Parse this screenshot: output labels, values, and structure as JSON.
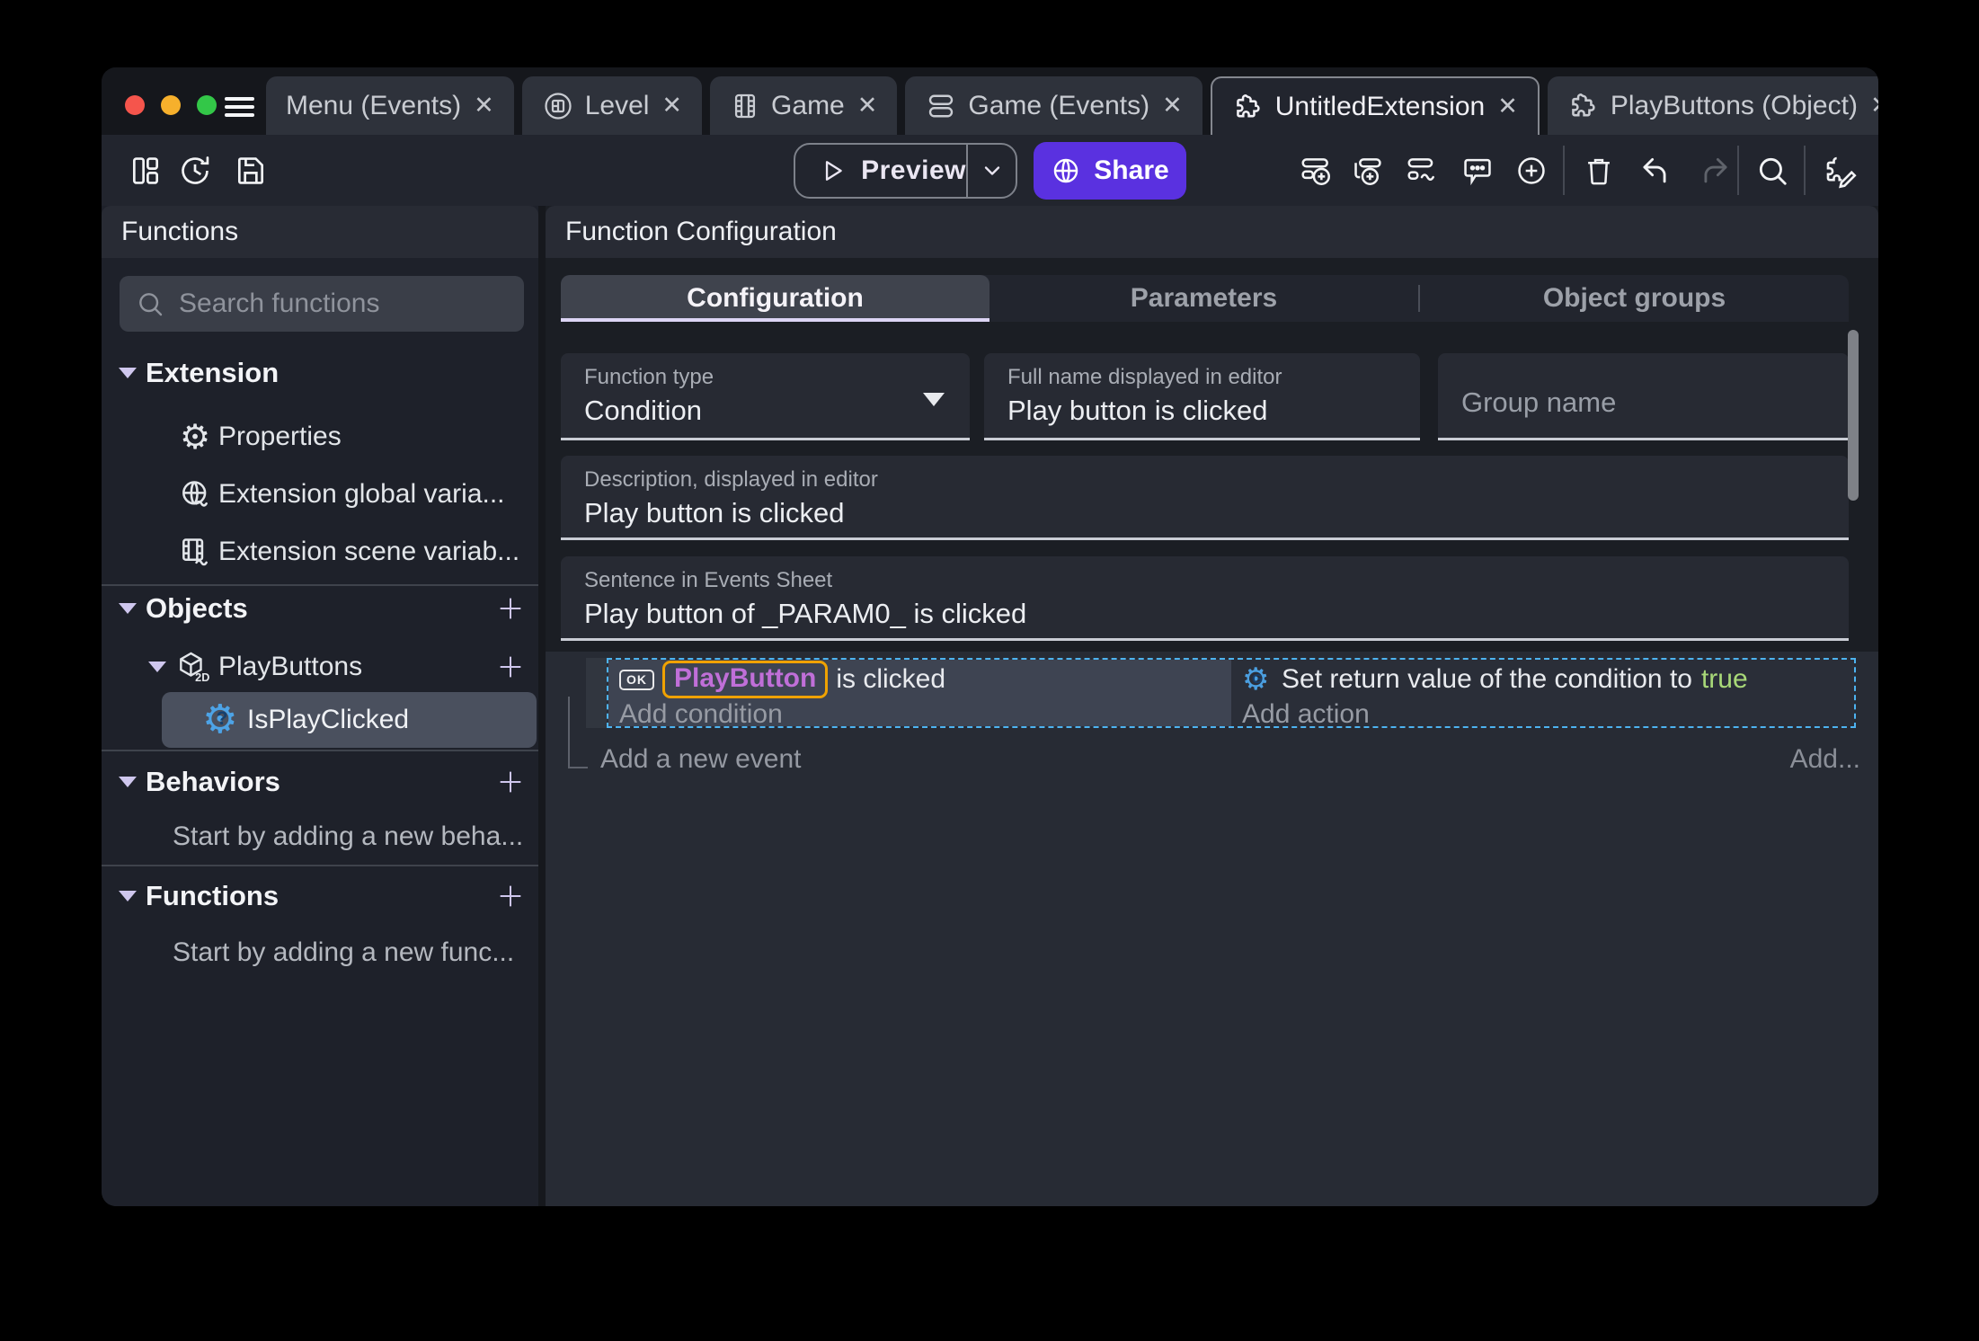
{
  "window": {
    "tabs": [
      {
        "label": "Menu (Events)",
        "icon": "none"
      },
      {
        "label": "Level",
        "icon": "scene-icon"
      },
      {
        "label": "Game",
        "icon": "film-icon"
      },
      {
        "label": "Game (Events)",
        "icon": "events-list-icon"
      },
      {
        "label": "UntitledExtension",
        "icon": "puzzle-icon",
        "active": true
      },
      {
        "label": "PlayButtons (Object)",
        "icon": "puzzle-icon"
      }
    ],
    "close_glyph": "✕"
  },
  "toolbar": {
    "preview_label": "Preview",
    "share_label": "Share"
  },
  "sidebar": {
    "title": "Functions",
    "search_placeholder": "Search functions",
    "sections": {
      "extension": {
        "label": "Extension",
        "items": [
          {
            "label": "Properties"
          },
          {
            "label": "Extension global varia..."
          },
          {
            "label": "Extension scene variab..."
          }
        ]
      },
      "objects": {
        "label": "Objects",
        "object_label": "PlayButtons",
        "object_type": "2D",
        "function_label": "IsPlayClicked"
      },
      "behaviors": {
        "label": "Behaviors",
        "empty_text": "Start by adding a new beha..."
      },
      "functions": {
        "label": "Functions",
        "empty_text": "Start by adding a new func..."
      }
    }
  },
  "main": {
    "title": "Function Configuration",
    "tabs": [
      "Configuration",
      "Parameters",
      "Object groups"
    ],
    "fields": {
      "function_type": {
        "label": "Function type",
        "value": "Condition"
      },
      "full_name": {
        "label": "Full name displayed in editor",
        "value": "Play button is clicked"
      },
      "group_name": {
        "placeholder": "Group name"
      },
      "description": {
        "label": "Description, displayed in editor",
        "value": "Play button is clicked"
      },
      "sentence": {
        "label": "Sentence in Events Sheet",
        "value": "Play button of _PARAM0_ is clicked"
      }
    },
    "events_sheet": {
      "condition": {
        "chip": "OK",
        "object_name": "PlayButton",
        "suffix": "is clicked",
        "add_label": "Add condition"
      },
      "action": {
        "text": "Set return value of the condition to",
        "value": "true",
        "add_label": "Add action"
      },
      "add_event_label": "Add a new event",
      "add_more_label": "Add..."
    }
  },
  "colors": {
    "accent_purple": "#5a31e0",
    "selection_blue": "#4db3f0",
    "highlight_orange": "#f0a202",
    "object_name_purple": "#c06fd8",
    "boolean_true_green": "#a8d878",
    "tab_underline": "#dcd4f4"
  }
}
